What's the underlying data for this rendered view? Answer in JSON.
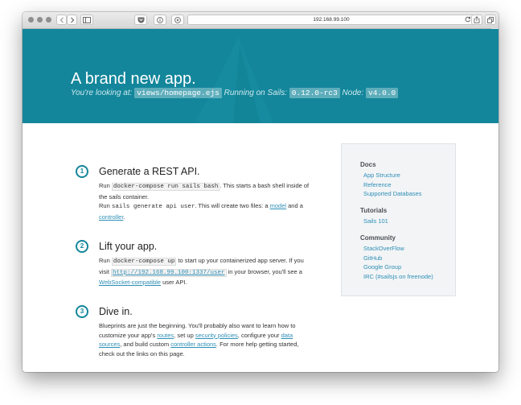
{
  "browser": {
    "url": "192.168.99.100"
  },
  "hero": {
    "title": "A brand new app.",
    "sub_prefix": "You're looking at: ",
    "view_path": "views/homepage.ejs",
    "running_label": " Running on Sails: ",
    "sails_version": "0.12.0-rc3",
    "node_label": " Node: ",
    "node_version": "v4.0.0",
    "background_color": "#13869b"
  },
  "steps": [
    {
      "number": "1",
      "title": "Generate a REST API.",
      "run": "Run ",
      "cmd1": "docker-compose run sails bash",
      "text1": ". This starts a bash shell inside of the sails container.",
      "run2": "Run ",
      "cmd2": "sails generate api user",
      "text2": ". This will create two files: a ",
      "link_model": "model",
      "and": " and a ",
      "link_controller": "controller",
      "end": "."
    },
    {
      "number": "2",
      "title": "Lift your app.",
      "run": "Run ",
      "cmd": "docker-compose up",
      "text1": " to start up your containerized app server. If you visit ",
      "link_url": "http://192.168.99.100:1337/user",
      "text2": " in your browser, you'll see a ",
      "link_ws": "WebSocket-compatible",
      "text3": " user API."
    },
    {
      "number": "3",
      "title": "Dive in.",
      "text1": "Blueprints are just the beginning. You'll probably also want to learn how to customize your app's ",
      "link_routes": "routes",
      "text2": ", set up ",
      "link_security": "security policies",
      "text3": ", configure your ",
      "link_data_sources": "data sources",
      "text4": ", and build custom ",
      "link_controller_actions": "controller actions",
      "text5": ". For more help getting started, check out the links on this page."
    }
  ],
  "sidebar": {
    "docs": {
      "heading": "Docs",
      "links": [
        "App Structure",
        "Reference",
        "Supported Databases"
      ]
    },
    "tutorials": {
      "heading": "Tutorials",
      "links": [
        "Sails 101"
      ]
    },
    "community": {
      "heading": "Community",
      "links": [
        "StackOverFlow",
        "GitHub",
        "Google Group",
        "IRC (#sailsjs on freenode)"
      ]
    }
  },
  "colors": {
    "accent": "#13869b",
    "link": "#2f8fb7"
  }
}
